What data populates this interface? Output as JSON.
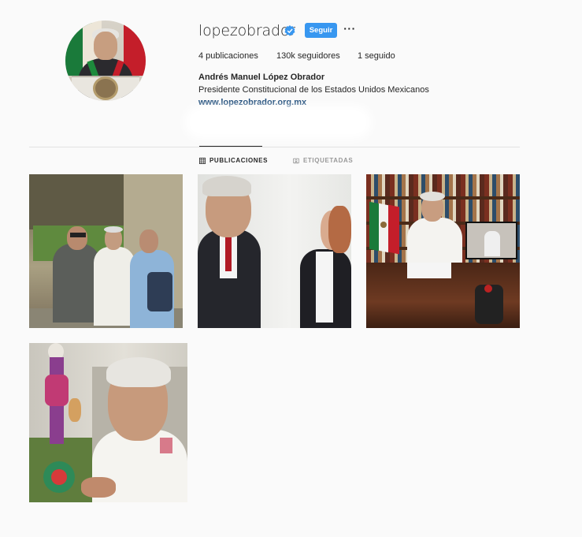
{
  "profile": {
    "username": "lopezobrador",
    "verified_icon": "verified-badge-icon",
    "follow_label": "Seguir",
    "more_label": "···",
    "posts_count": "4 publicaciones",
    "followers_count": "130k seguidores",
    "following_count": "1 seguido",
    "full_name": "Andrés Manuel López Obrador",
    "bio": "Presidente Constitucional de los Estados Unidos Mexicanos",
    "website": "www.lopezobrador.org.mx"
  },
  "tabs": [
    {
      "label": "PUBLICACIONES",
      "icon": "grid-icon",
      "active": true
    },
    {
      "label": "ETIQUETADAS",
      "icon": "tag-icon",
      "active": false
    }
  ],
  "colors": {
    "accent": "#3897f0",
    "text": "#262626",
    "muted": "#999999",
    "background": "#fafafa",
    "link": "#003569"
  },
  "posts": [
    {
      "description_icon": "photo-three-men-ruins"
    },
    {
      "description_icon": "photo-man-and-woman"
    },
    {
      "description_icon": "photo-man-at-desk-flag"
    },
    {
      "description_icon": "photo-man-with-figurine"
    }
  ]
}
